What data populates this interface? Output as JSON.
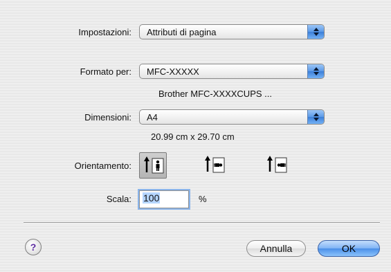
{
  "settings": {
    "label": "Impostazioni:",
    "value": "Attributi di pagina"
  },
  "format": {
    "label": "Formato per:",
    "value": "MFC-XXXXX",
    "detail": "Brother MFC-XXXXCUPS ..."
  },
  "size": {
    "label": "Dimensioni:",
    "value": "A4",
    "detail": "20.99 cm x 29.70 cm"
  },
  "orientation": {
    "label": "Orientamento:",
    "options": [
      {
        "icon": "portrait-orientation-icon",
        "selected": true
      },
      {
        "icon": "landscape-orientation-icon",
        "selected": false
      },
      {
        "icon": "reverse-landscape-orientation-icon",
        "selected": false
      }
    ]
  },
  "scale": {
    "label": "Scala:",
    "value": "100",
    "unit": "%"
  },
  "footer": {
    "help": "?",
    "cancel_label": "Annulla",
    "ok_label": "OK"
  },
  "colors": {
    "accent": "#5b9ae8",
    "background": "#ececec"
  }
}
